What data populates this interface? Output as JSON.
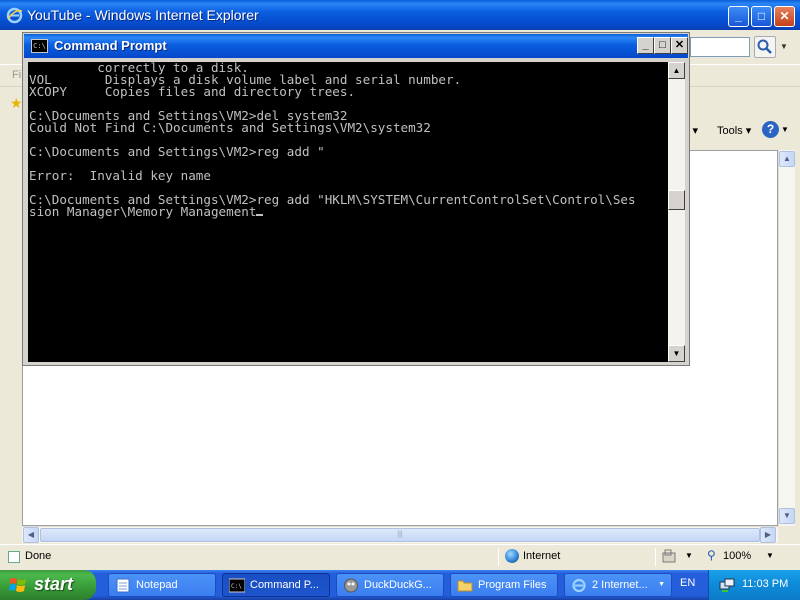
{
  "ie": {
    "title": "YouTube - Windows Internet Explorer",
    "menu_partial": "Fi",
    "page_menu": "y ▾",
    "tools_menu": "Tools ▾",
    "help_label": "?",
    "status_text": "Done",
    "zone_text": "Internet",
    "zoom_text": "100%"
  },
  "cmd": {
    "title": "Command Prompt",
    "lines": [
      "         correctly to a disk.",
      "VOL       Displays a disk volume label and serial number.",
      "XCOPY     Copies files and directory trees.",
      "",
      "C:\\Documents and Settings\\VM2>del system32",
      "Could Not Find C:\\Documents and Settings\\VM2\\system32",
      "",
      "C:\\Documents and Settings\\VM2>reg add \"",
      "",
      "Error:  Invalid key name",
      "",
      "C:\\Documents and Settings\\VM2>reg add \"HKLM\\SYSTEM\\CurrentControlSet\\Control\\Ses",
      "sion Manager\\Memory Management"
    ]
  },
  "taskbar": {
    "start_label": "start",
    "items": [
      {
        "label": "Notepad",
        "icon": "notepad-icon"
      },
      {
        "label": "Command P...",
        "icon": "cmd-icon"
      },
      {
        "label": "DuckDuckG...",
        "icon": "duckduckgo-icon"
      },
      {
        "label": "Program Files",
        "icon": "folder-icon"
      },
      {
        "label": "2 Internet...",
        "icon": "ie-icon"
      }
    ],
    "language": "EN",
    "clock": "11:03 PM"
  }
}
